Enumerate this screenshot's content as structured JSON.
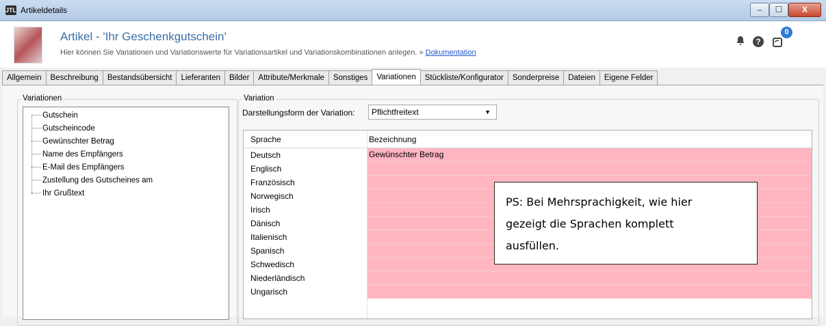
{
  "window": {
    "title": "Artikeldetails",
    "app_icon": "JTL",
    "minimize": "–",
    "maximize": "☐",
    "close": "X"
  },
  "header": {
    "title": "Artikel - 'Ihr Geschenkgutschein'",
    "subtitle": "Hier können Sie Variationen und Variationswerte für Variationsartikel und Variationskombinationen anlegen. » ",
    "doc_link": "Dokumentation",
    "notification_count": "0"
  },
  "tabs": [
    {
      "label": "Allgemein"
    },
    {
      "label": "Beschreibung"
    },
    {
      "label": "Bestandsübersicht"
    },
    {
      "label": "Lieferanten"
    },
    {
      "label": "Bilder"
    },
    {
      "label": "Attribute/Merkmale"
    },
    {
      "label": "Sonstiges"
    },
    {
      "label": "Variationen",
      "active": true
    },
    {
      "label": "Stückliste/Konfigurator"
    },
    {
      "label": "Sonderpreise"
    },
    {
      "label": "Dateien"
    },
    {
      "label": "Eigene Felder"
    }
  ],
  "variations_group": {
    "label": "Variationen",
    "items": [
      "Gutschein",
      "Gutscheincode",
      "Gewünschter Betrag",
      "Name des Empfängers",
      "E-Mail des Empfängers",
      "Zustellung des Gutscheines am",
      "Ihr Grußtext"
    ]
  },
  "variation_group": {
    "label": "Variation",
    "display_form_label": "Darstellungsform der Variation:",
    "display_form_value": "Pflichtfreitext"
  },
  "grid": {
    "headers": [
      "Sprache",
      "Bezeichnung"
    ],
    "rows": [
      {
        "language": "Deutsch",
        "name": "Gewünschter Betrag"
      },
      {
        "language": "Englisch",
        "name": ""
      },
      {
        "language": "Französisch",
        "name": ""
      },
      {
        "language": "Norwegisch",
        "name": ""
      },
      {
        "language": "Irisch",
        "name": ""
      },
      {
        "language": "Dänisch",
        "name": ""
      },
      {
        "language": "Italienisch",
        "name": ""
      },
      {
        "language": "Spanisch",
        "name": ""
      },
      {
        "language": "Schwedisch",
        "name": ""
      },
      {
        "language": "Niederländisch",
        "name": ""
      },
      {
        "language": "Ungarisch",
        "name": ""
      }
    ],
    "highlight_color": "#ffb6c1"
  },
  "note": {
    "lines": [
      "PS: Bei Mehrsprachigkeit, wie hier",
      "gezeigt die Sprachen komplett",
      "ausfüllen."
    ]
  }
}
